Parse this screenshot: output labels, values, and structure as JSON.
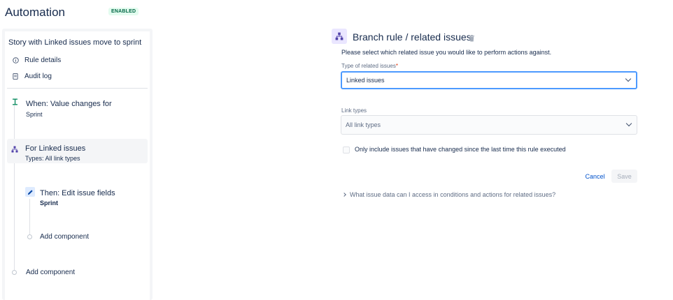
{
  "header": {
    "title": "Automation",
    "status": "ENABLED"
  },
  "sidebar": {
    "rule_name": "Story with Linked issues move to sprint",
    "links": [
      {
        "label": "Rule details",
        "icon": "info-icon"
      },
      {
        "label": "Audit log",
        "icon": "audit-log-icon"
      }
    ],
    "trigger": {
      "title": "When: Value changes for",
      "subtitle": "Sprint"
    },
    "branch": {
      "title": "For Linked issues",
      "subtitle": "Types: All link types"
    },
    "action": {
      "title": "Then: Edit issue fields",
      "subtitle": "Sprint"
    },
    "add_component_inner": "Add component",
    "add_component_outer": "Add component"
  },
  "panel": {
    "title": "Branch rule / related issues",
    "description": "Please select which related issue you would like to perform actions against.",
    "type_label": "Type of related issues",
    "type_required": "*",
    "type_value": "Linked issues",
    "link_types_label": "Link types",
    "link_types_placeholder": "All link types",
    "checkbox_label": "Only include issues that have changed since the last time this rule executed",
    "checkbox_checked": false,
    "cancel_label": "Cancel",
    "save_label": "Save",
    "help_link": "What issue data can I access in conditions and actions for related issues?"
  },
  "colors": {
    "accent": "#0052cc",
    "focus_border": "#4c9aff",
    "badge_bg": "#e3fcef",
    "badge_text": "#006644",
    "branch_icon_bg": "#eae6ff"
  }
}
